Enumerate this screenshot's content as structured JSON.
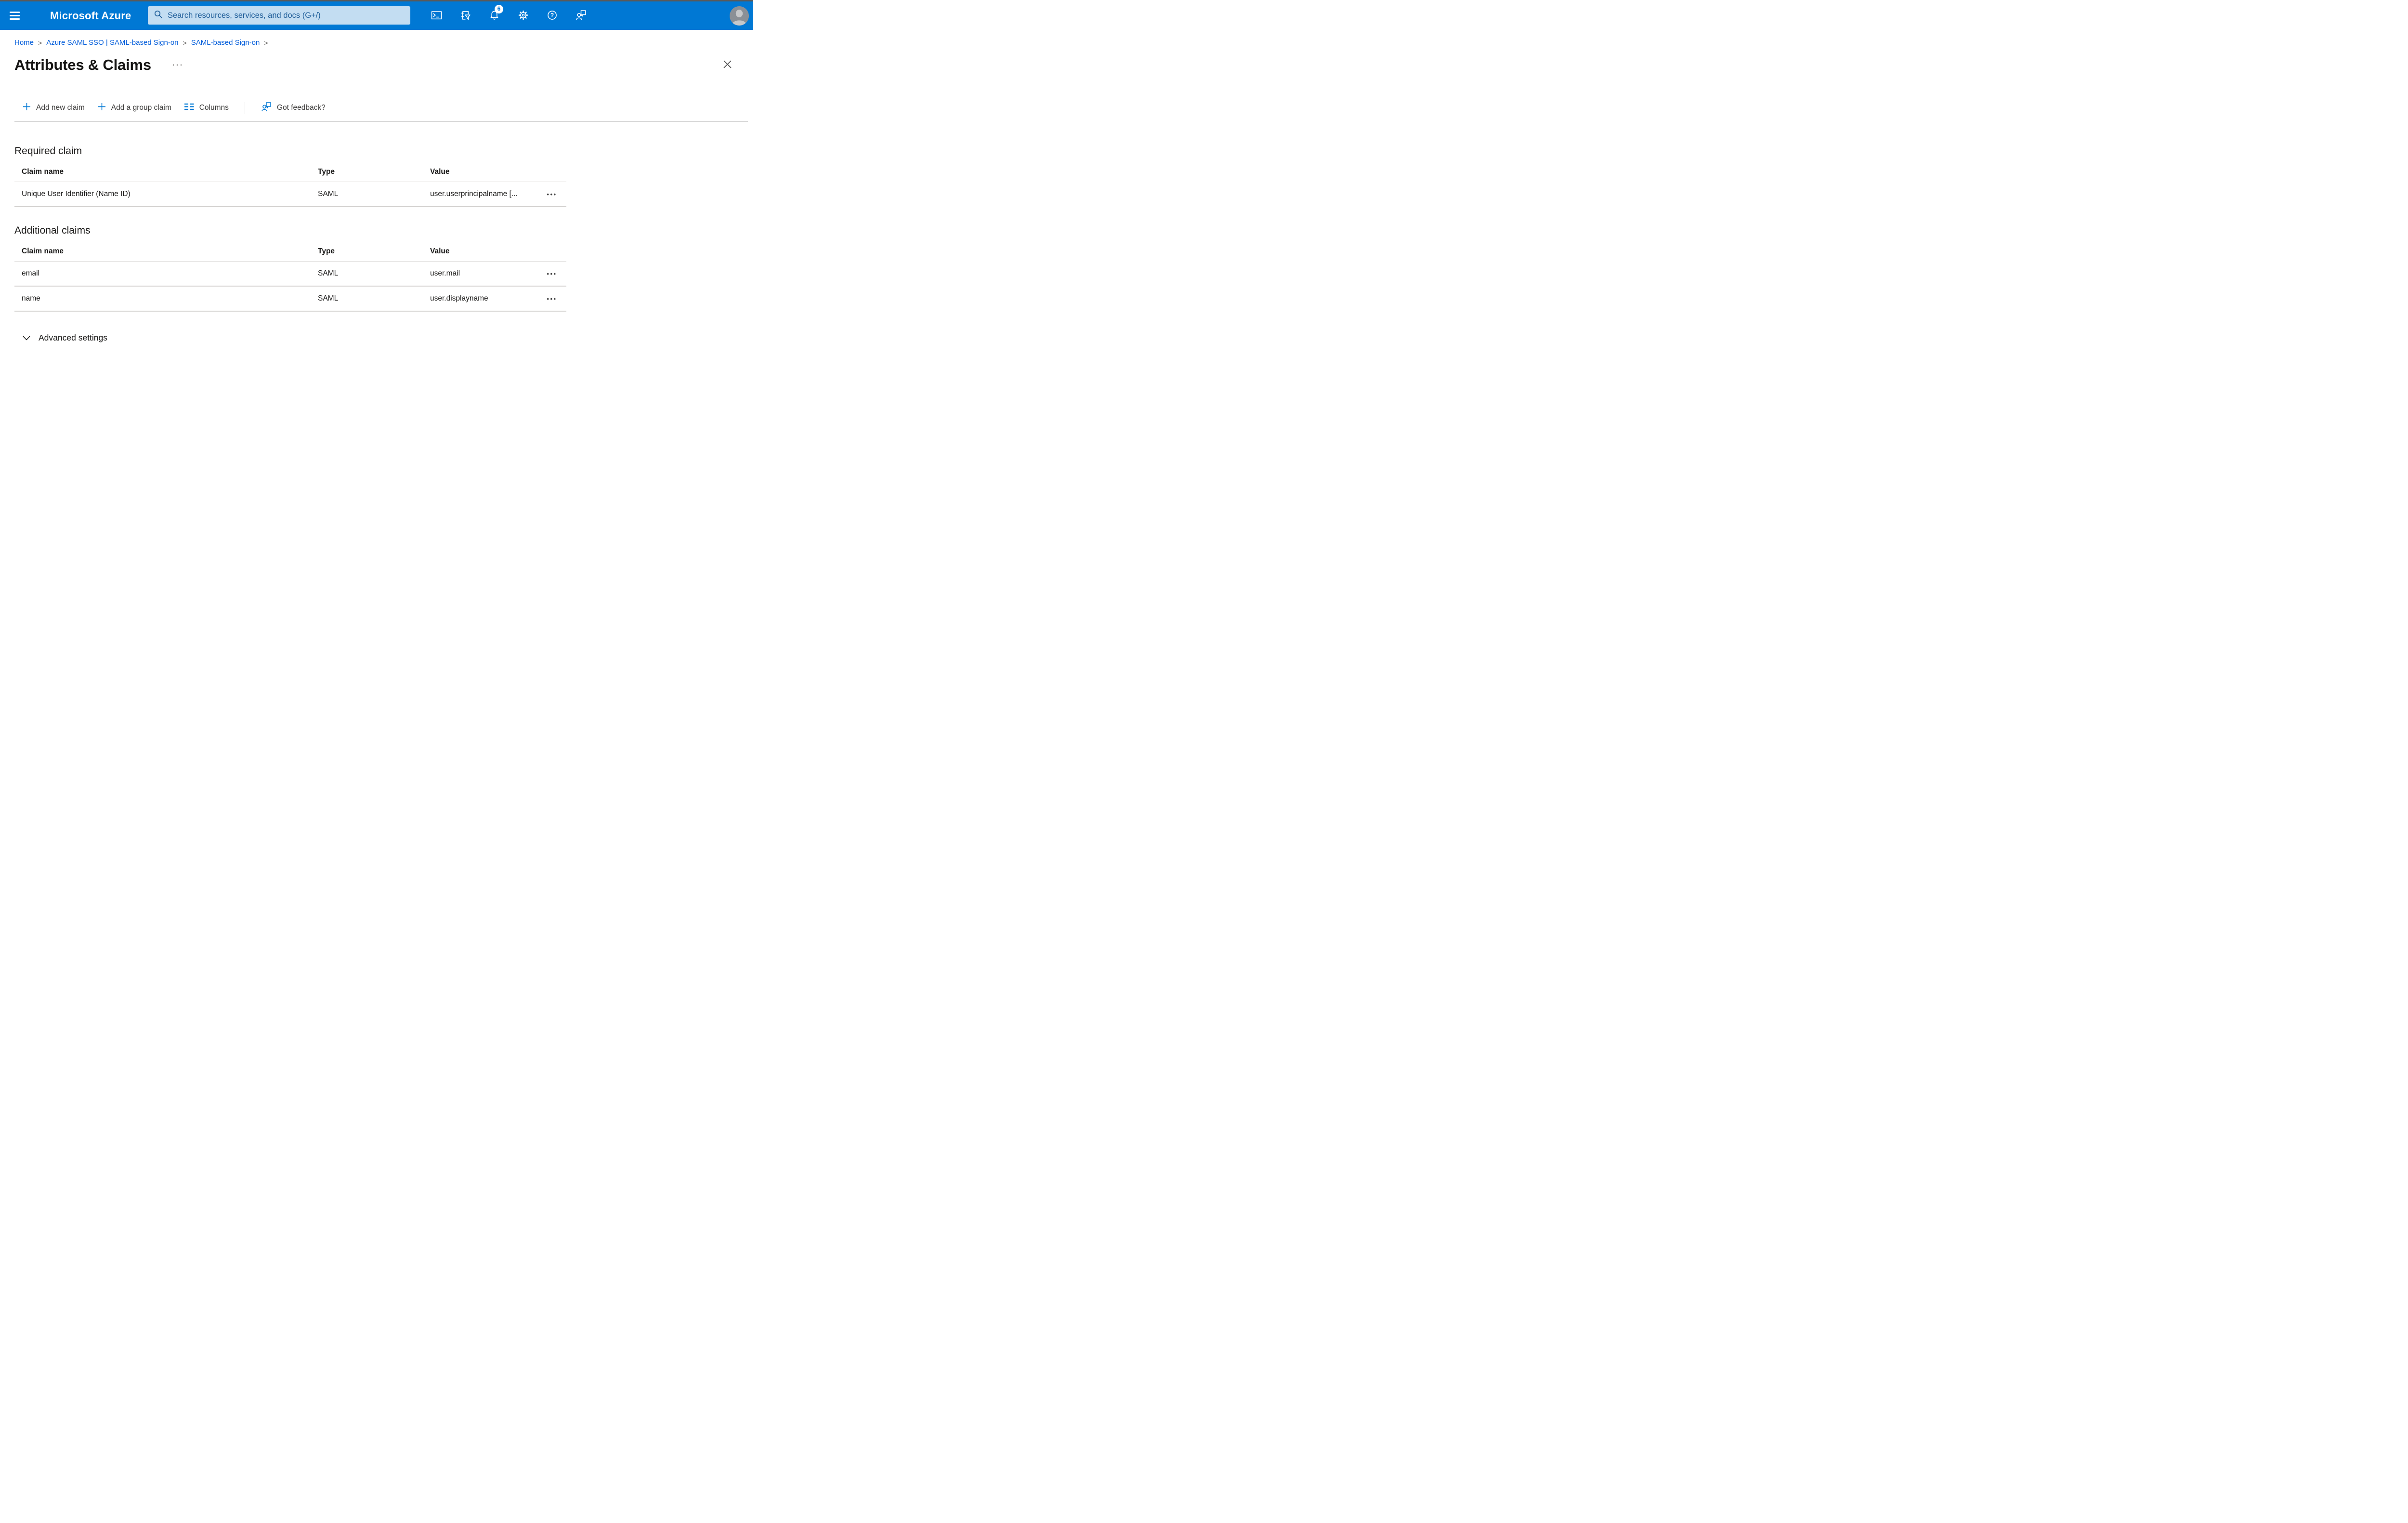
{
  "colors": {
    "topbar": "#0078d4",
    "accent": "#0078d4",
    "link": "#015cda",
    "search_bg": "#c3ddf2"
  },
  "topbar": {
    "brand": "Microsoft Azure",
    "search_placeholder": "Search resources, services, and docs (G+/)",
    "notification_count": "6"
  },
  "breadcrumb": {
    "separator": ">",
    "items": [
      "Home",
      "Azure SAML SSO | SAML-based Sign-on",
      "SAML-based Sign-on"
    ]
  },
  "page": {
    "title": "Attributes & Claims",
    "more_label": "···"
  },
  "toolbar": {
    "add_new_claim": "Add new claim",
    "add_group_claim": "Add a group claim",
    "columns": "Columns",
    "got_feedback": "Got feedback?"
  },
  "tables": {
    "required": {
      "heading": "Required claim",
      "headers": {
        "name": "Claim name",
        "type": "Type",
        "value": "Value"
      },
      "rows": [
        {
          "name": "Unique User Identifier (Name ID)",
          "type": "SAML",
          "value": "user.userprincipalname [...",
          "menu": "•••"
        }
      ]
    },
    "additional": {
      "heading": "Additional claims",
      "headers": {
        "name": "Claim name",
        "type": "Type",
        "value": "Value"
      },
      "rows": [
        {
          "name": "email",
          "type": "SAML",
          "value": "user.mail",
          "menu": "•••"
        },
        {
          "name": "name",
          "type": "SAML",
          "value": "user.displayname",
          "menu": "•••"
        }
      ]
    }
  },
  "advanced": {
    "label": "Advanced settings"
  }
}
